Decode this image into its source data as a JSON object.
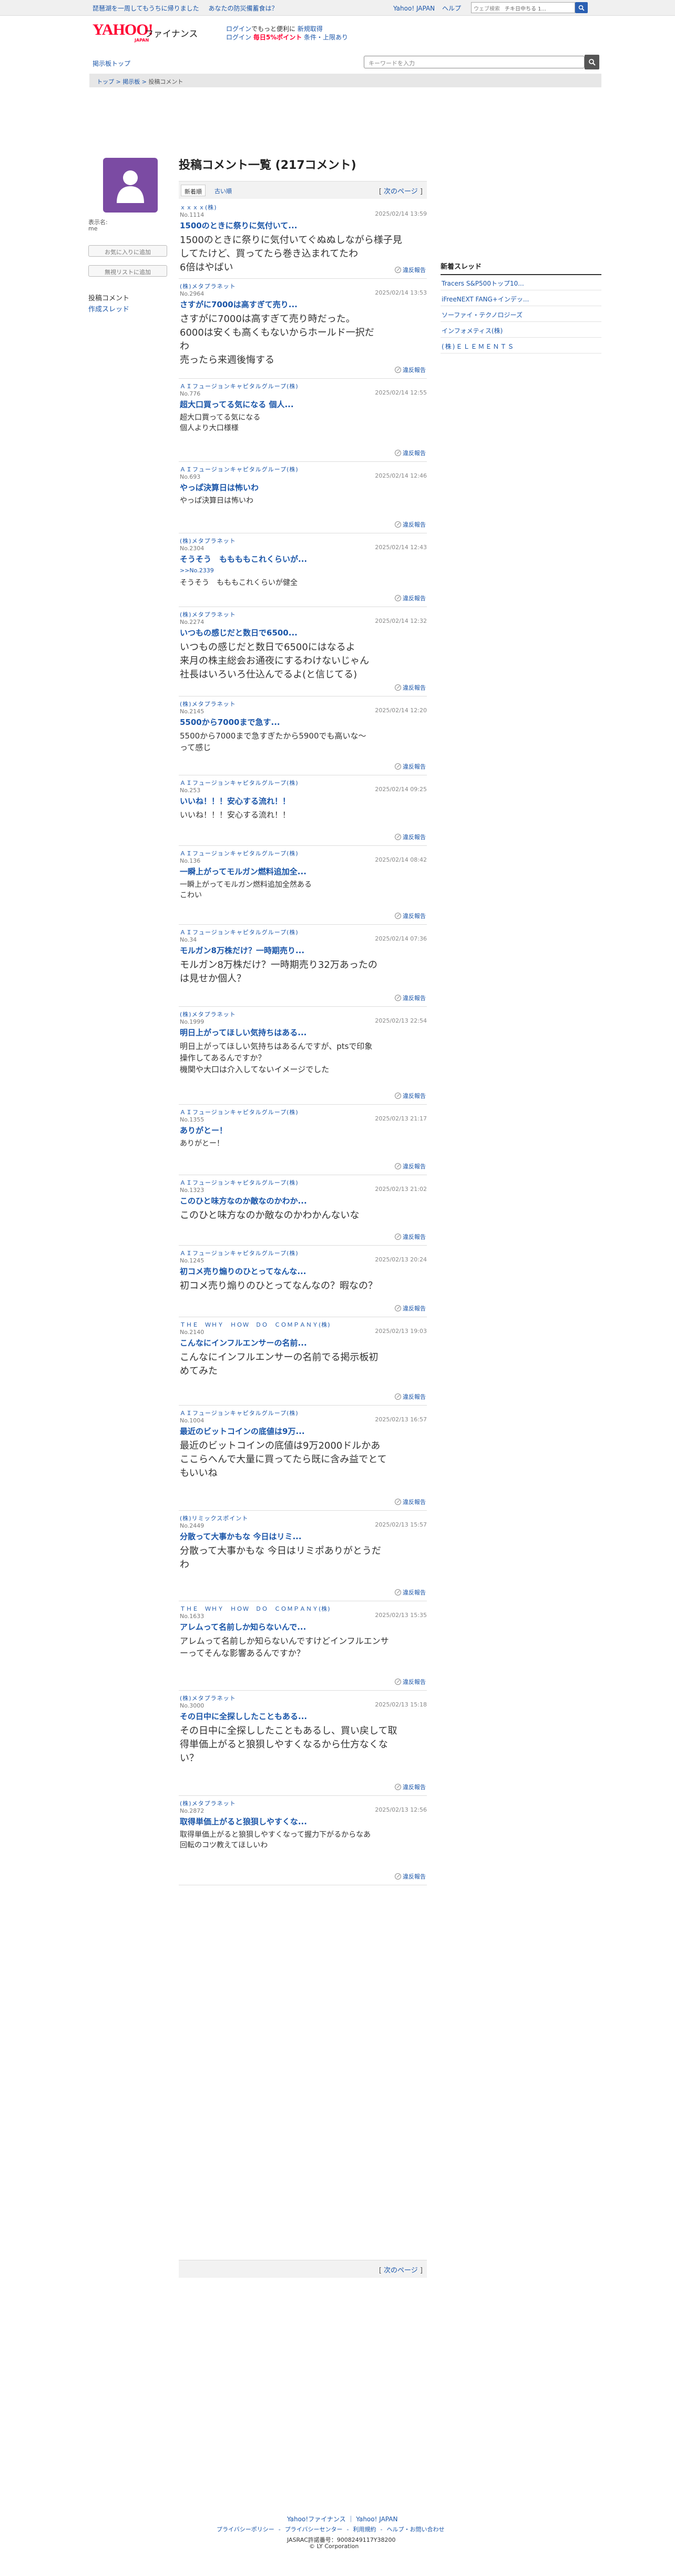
{
  "topbar": {
    "promo1": "琵琶湖を一周してもうちに帰りました",
    "promo2": "あなたの防災備蓄食は？",
    "link_yahoo": "Yahoo! JAPAN",
    "link_help": "ヘルプ",
    "websearch_placeholder": "ウェブ検索",
    "websearch_hint": "チキ日中ちる 1..."
  },
  "header": {
    "logo": "YAHOO!",
    "logo_sub": "JAPAN",
    "app_name": "ファイナンス",
    "promo_line1_a": "ログイン",
    "promo_line1_b": "でもっと便利に",
    "promo_line1_c": "新規取得",
    "promo_line2_a": "ログイン",
    "promo_line2_b": "毎日5%ポイント",
    "promo_line2_c": "条件・上限あり"
  },
  "nav": {
    "home": "掲示板トップ",
    "search_placeholder": "キーワードを入力"
  },
  "breadcrumb": {
    "top": "トップ",
    "board": "掲示板",
    "current": "投稿コメント",
    "sep": " > "
  },
  "sidebar": {
    "user_label": "表示名:",
    "user_value": "me",
    "add_favorite": "お気に入りに追加",
    "add_block": "無視リストに追加",
    "comments_link": "投稿コメント",
    "threads_link": "作成スレッド"
  },
  "main": {
    "title": "投稿コメント一覧 (217コメント)",
    "tab_new": "新着順",
    "tab_old": "古い順",
    "next_page": "次のページ",
    "report_label": "違反報告"
  },
  "comments": [
    {
      "company": "ｘｘｘｘ(株)",
      "no": "No.1114",
      "date": "2025/02/14 13:59",
      "title": "1500のときに祭りに気付いて...",
      "body": "1500のときに祭りに気付いてぐぬぬしながら様子見\nしてたけど、買ってたら巻き込まれてたわ\n6倍はやばい"
    },
    {
      "company": "(株)メタプラネット",
      "no": "No.2964",
      "date": "2025/02/14 13:53",
      "title": "さすがに7000は高すぎて売り...",
      "body": "さすがに7000は高すぎて売り時だった。\n6000は安くも高くもないからホールド一択だ\nわ\n売ったら来週後悔する"
    },
    {
      "company": "ＡＩフュージョンキャピタルグループ(株)",
      "no": "No.776",
      "date": "2025/02/14 12:55",
      "title": "超大口買ってる気になる 個人...",
      "body": "超大口買ってる気になる\n個人より大口様様"
    },
    {
      "company": "ＡＩフュージョンキャピタルグループ(株)",
      "no": "No.693",
      "date": "2025/02/14 12:46",
      "title": "やっぱ決算日は怖いわ",
      "body": "やっぱ決算日は怖いわ"
    },
    {
      "company": "(株)メタプラネット",
      "no": "No.2304",
      "date": "2025/02/14 12:43",
      "title": "そうそう　ももももこれくらいが...",
      "body": "そうそう　もももこれくらいが健全",
      "reply": ">>No.2339"
    },
    {
      "company": "(株)メタプラネット",
      "no": "No.2274",
      "date": "2025/02/14 12:32",
      "title": "いつもの感じだと数日で6500...",
      "body": "いつもの感じだと数日で6500にはなるよ\n来月の株主総会お通夜にするわけないじゃん\n社長はいろいろ仕込んでるよ(と信じてる)"
    },
    {
      "company": "(株)メタプラネット",
      "no": "No.2145",
      "date": "2025/02/14 12:20",
      "title": "5500から7000まで急す...",
      "body": "5500から7000まで急すぎたから5900でも高いな〜\nって感じ"
    },
    {
      "company": "ＡＩフュージョンキャピタルグループ(株)",
      "no": "No.253",
      "date": "2025/02/14 09:25",
      "title": "いいね！！！安心する流れ！！",
      "body": "いいね！！！安心する流れ！！"
    },
    {
      "company": "ＡＩフュージョンキャピタルグループ(株)",
      "no": "No.136",
      "date": "2025/02/14 08:42",
      "title": "一瞬上がってモルガン燃料追加全...",
      "body": "一瞬上がってモルガン燃料追加全然ある\nこわい"
    },
    {
      "company": "ＡＩフュージョンキャピタルグループ(株)",
      "no": "No.34",
      "date": "2025/02/14 07:36",
      "title": "モルガン8万株だけ？一時期売り...",
      "body": "モルガン8万株だけ？一時期売り32万あったの\nは見せか個人？"
    },
    {
      "company": "(株)メタプラネット",
      "no": "No.1999",
      "date": "2025/02/13 22:54",
      "title": "明日上がってほしい気持ちはある...",
      "body": "明日上がってほしい気持ちはあるんですが、ptsで印象\n操作してあるんですか？\n機関や大口は介入してないイメージでした"
    },
    {
      "company": "ＡＩフュージョンキャピタルグループ(株)",
      "no": "No.1355",
      "date": "2025/02/13 21:17",
      "title": "ありがとー！",
      "body": "ありがとー！"
    },
    {
      "company": "ＡＩフュージョンキャピタルグループ(株)",
      "no": "No.1323",
      "date": "2025/02/13 21:02",
      "title": "このひと味方なのか敵なのかわか...",
      "body": "このひと味方なのか敵なのかわかんないな"
    },
    {
      "company": "ＡＩフュージョンキャピタルグループ(株)",
      "no": "No.1245",
      "date": "2025/02/13 20:24",
      "title": "初コメ売り煽りのひとってなんな...",
      "body": "初コメ売り煽りのひとってなんなの？暇なの？"
    },
    {
      "company": "ＴＨＥ　ＷＨＹ　ＨＯＷ　ＤＯ　ＣＯＭＰＡＮＹ(株)",
      "no": "No.2140",
      "date": "2025/02/13 19:03",
      "title": "こんなにインフルエンサーの名前...",
      "body": "こんなにインフルエンサーの名前でる掲示板初\nめてみた"
    },
    {
      "company": "ＡＩフュージョンキャピタルグループ(株)",
      "no": "No.1004",
      "date": "2025/02/13 16:57",
      "title": "最近のビットコインの底値は9万...",
      "body": "最近のビットコインの底値は9万2000ドルかあ\nここらへんで大量に買ってたら既に含み益でとて\nもいいね"
    },
    {
      "company": "(株)リミックスポイント",
      "no": "No.2449",
      "date": "2025/02/13 15:57",
      "title": "分散って大事かもな 今日はリミ...",
      "body": "分散って大事かもな 今日はリミポありがとうだ\nわ"
    },
    {
      "company": "ＴＨＥ　ＷＨＹ　ＨＯＷ　ＤＯ　ＣＯＭＰＡＮＹ(株)",
      "no": "No.1633",
      "date": "2025/02/13 15:35",
      "title": "アレムって名前しか知らないんで...",
      "body": "アレムって名前しか知らないんですけどインフルエンサ\nーってそんな影響あるんですか？"
    },
    {
      "company": "(株)メタプラネット",
      "no": "No.3000",
      "date": "2025/02/13 15:18",
      "title": "その日中に全探ししたこともある...",
      "body": "その日中に全探ししたこともあるし、買い戻して取\n得単価上がると狼狽しやすくなるから仕方なくな\nい？"
    },
    {
      "company": "(株)メタプラネット",
      "no": "No.2872",
      "date": "2025/02/13 12:56",
      "title": "取得単価上がると狼狽しやすくな...",
      "body": "取得単価上がると狼狽しやすくなって握力下がるからなあ\n回転のコツ教えてほしいわ"
    }
  ],
  "right_sidebar": {
    "title": "新着スレッド",
    "items": [
      "Tracers S&P500トップ10...",
      "iFreeNEXT FANG+インデッ...",
      "ソーファイ・テクノロジーズ",
      "インフォメティス(株)",
      "(株)ＥＬＥＭＥＮＴＳ"
    ]
  },
  "footer": {
    "l1_a": "Yahoo!ファイナンス",
    "l1_b": "Yahoo! JAPAN",
    "privacy": "プライバシーポリシー",
    "privacy_center": "プライバシーセンター",
    "terms": "利用規約",
    "help": "ヘルプ・お問い合わせ",
    "license": "JASRAC許諾番号：9008249117Y38200",
    "copyright": "© LY Corporation"
  }
}
